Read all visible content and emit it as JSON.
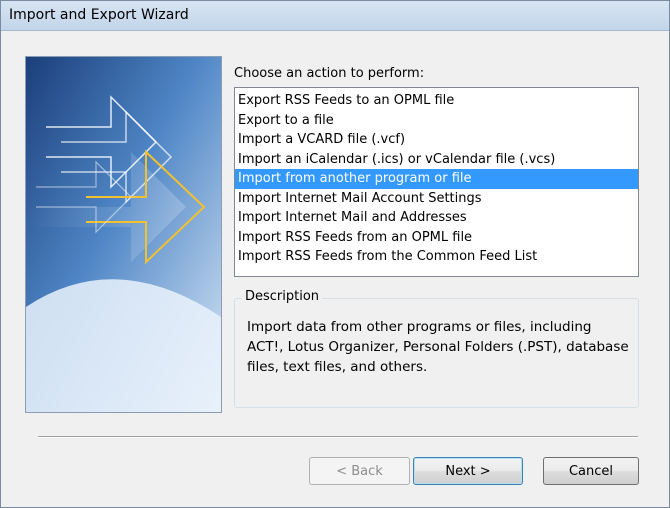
{
  "window": {
    "title": "Import and Export Wizard"
  },
  "prompt": {
    "label": "Choose an action to perform:"
  },
  "actions": {
    "items": [
      "Export RSS Feeds to an OPML file",
      "Export to a file",
      "Import a VCARD file (.vcf)",
      "Import an iCalendar (.ics) or vCalendar file (.vcs)",
      "Import from another program or file",
      "Import Internet Mail Account Settings",
      "Import Internet Mail and Addresses",
      "Import RSS Feeds from an OPML file",
      "Import RSS Feeds from the Common Feed List"
    ],
    "selected_index": 4
  },
  "description": {
    "legend": "Description",
    "text": "Import data from other programs or files, including ACT!, Lotus Organizer, Personal Folders (.PST), database files, text files, and others."
  },
  "buttons": {
    "back": "< Back",
    "next": "Next >",
    "cancel": "Cancel"
  },
  "colors": {
    "selection": "#3399ff",
    "title_bar": "#c9daee",
    "arrow_accent": "#f2c12e"
  }
}
